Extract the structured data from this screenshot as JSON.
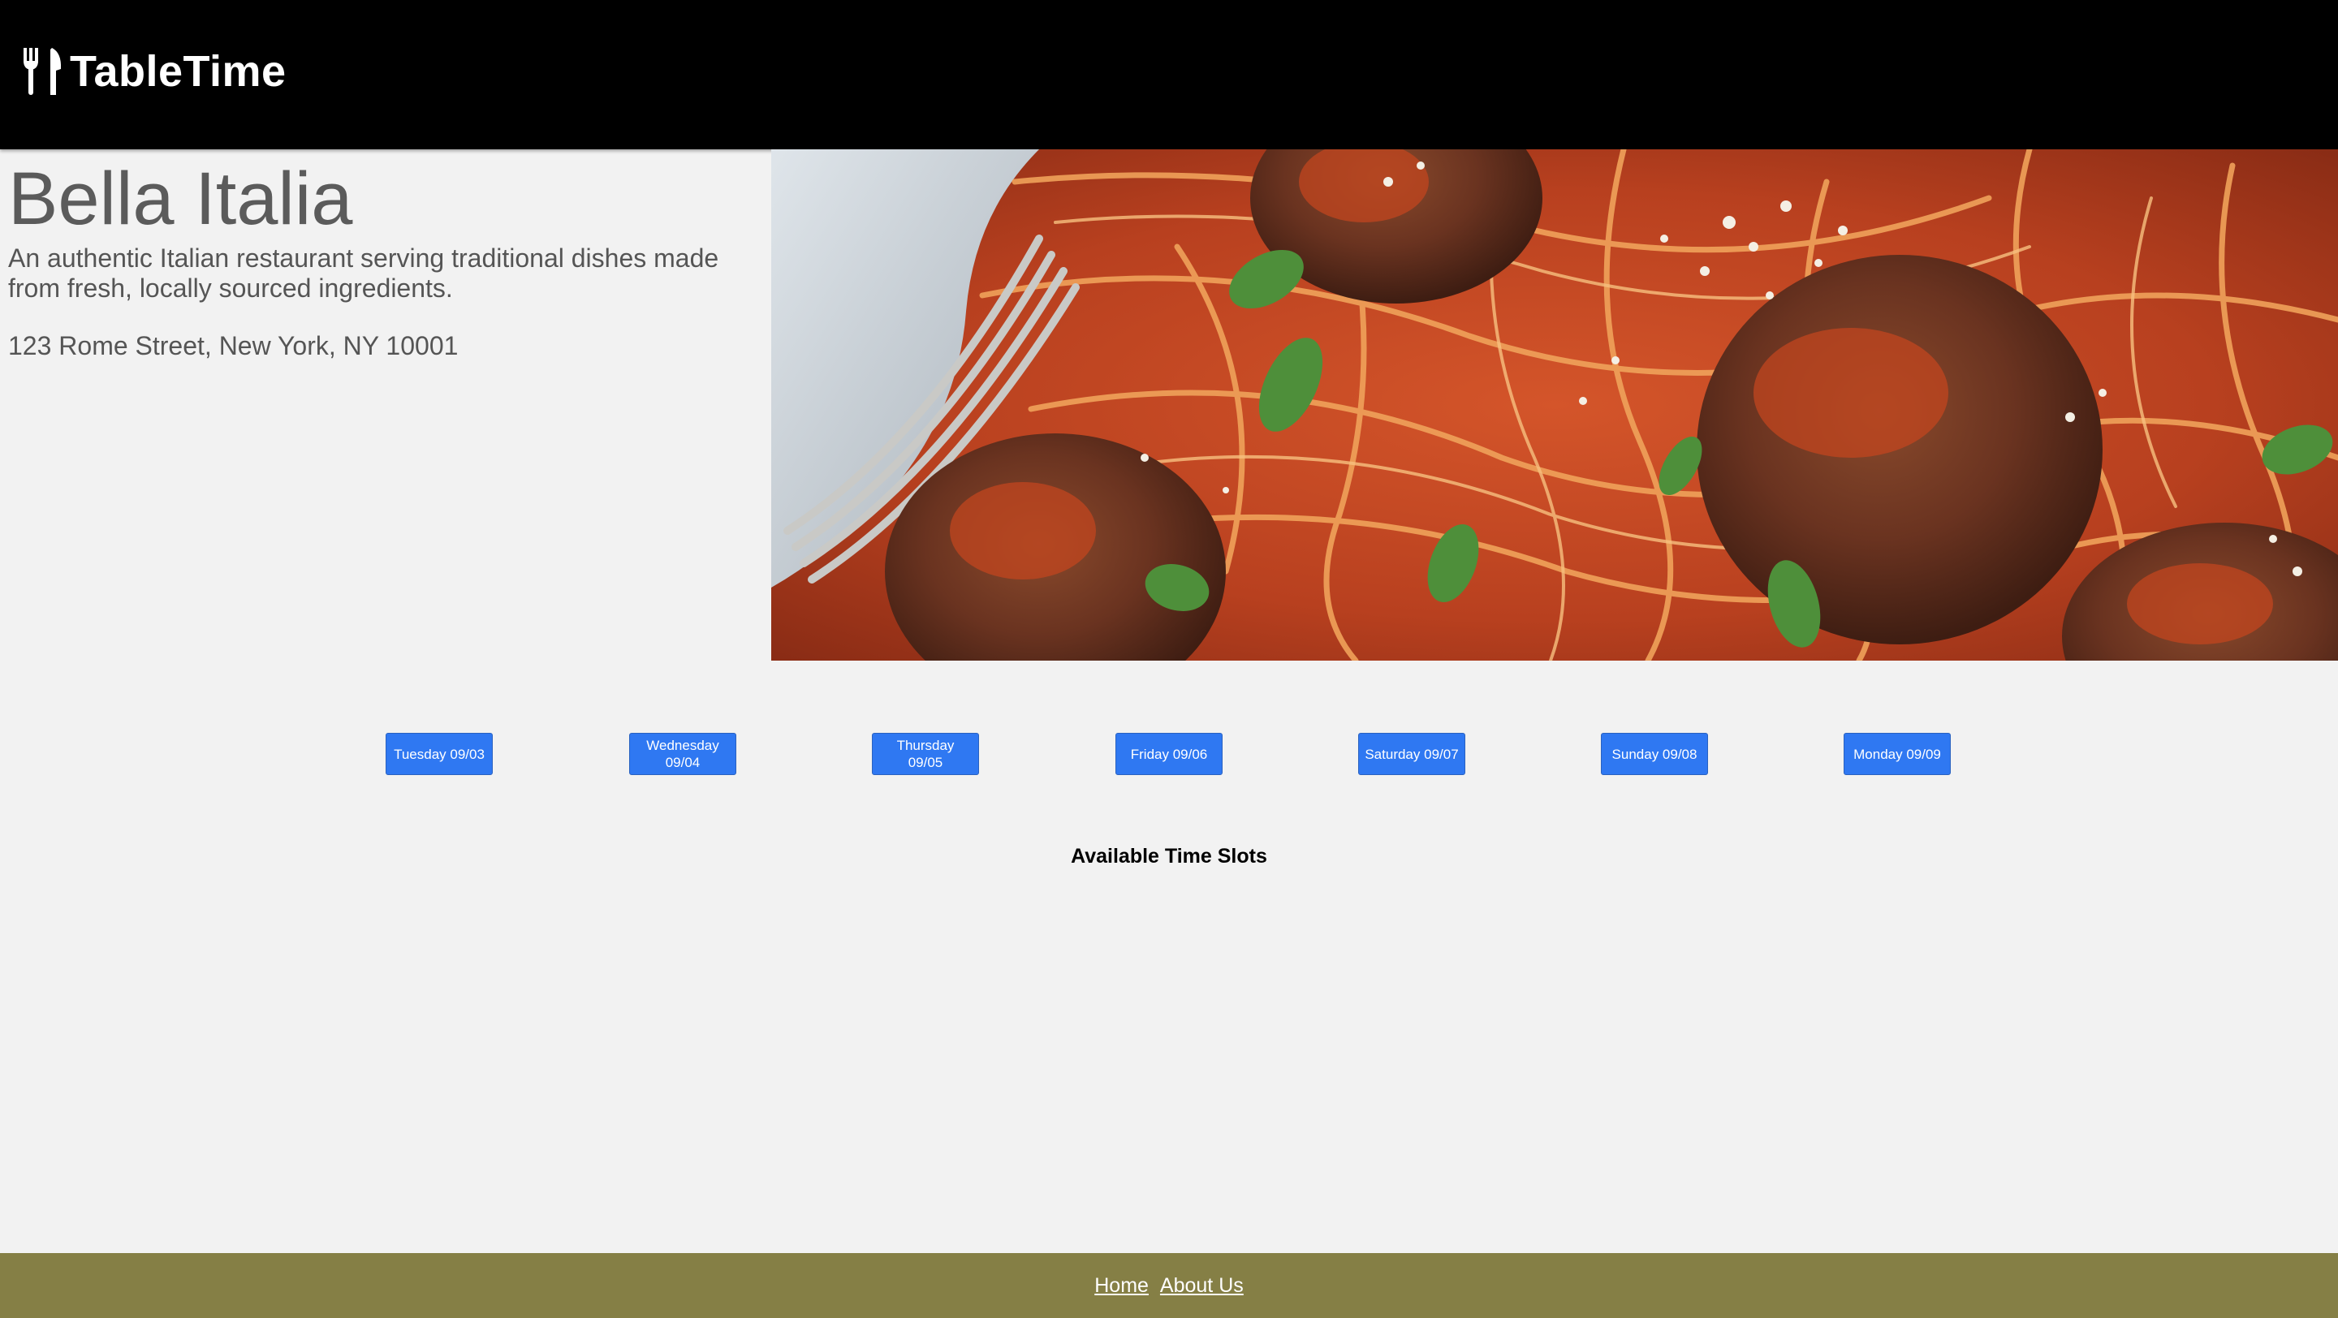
{
  "header": {
    "brand_name": "TableTime",
    "brand_icon": "fork-knife-icon",
    "background_color": "#000000"
  },
  "restaurant": {
    "name": "Bella Italia",
    "description": "An authentic Italian restaurant serving traditional dishes made from fresh, locally sourced ingredients.",
    "address": "123 Rome Street, New York, NY 10001",
    "image_subject": "spaghetti-with-meatballs-photo"
  },
  "days": [
    {
      "label": "Tuesday 09/03"
    },
    {
      "label": "Wednesday 09/04"
    },
    {
      "label": "Thursday 09/05"
    },
    {
      "label": "Friday 09/06"
    },
    {
      "label": "Saturday 09/07"
    },
    {
      "label": "Sunday 09/08"
    },
    {
      "label": "Monday 09/09"
    }
  ],
  "time_slots": {
    "heading": "Available Time Slots"
  },
  "footer": {
    "links": [
      {
        "label": "Home"
      },
      {
        "label": "About Us"
      }
    ],
    "background_color": "#857f45"
  },
  "colors": {
    "accent_button": "#2f78f2",
    "page_background": "#f2f2f2",
    "text_gray": "#5b5b5b"
  }
}
